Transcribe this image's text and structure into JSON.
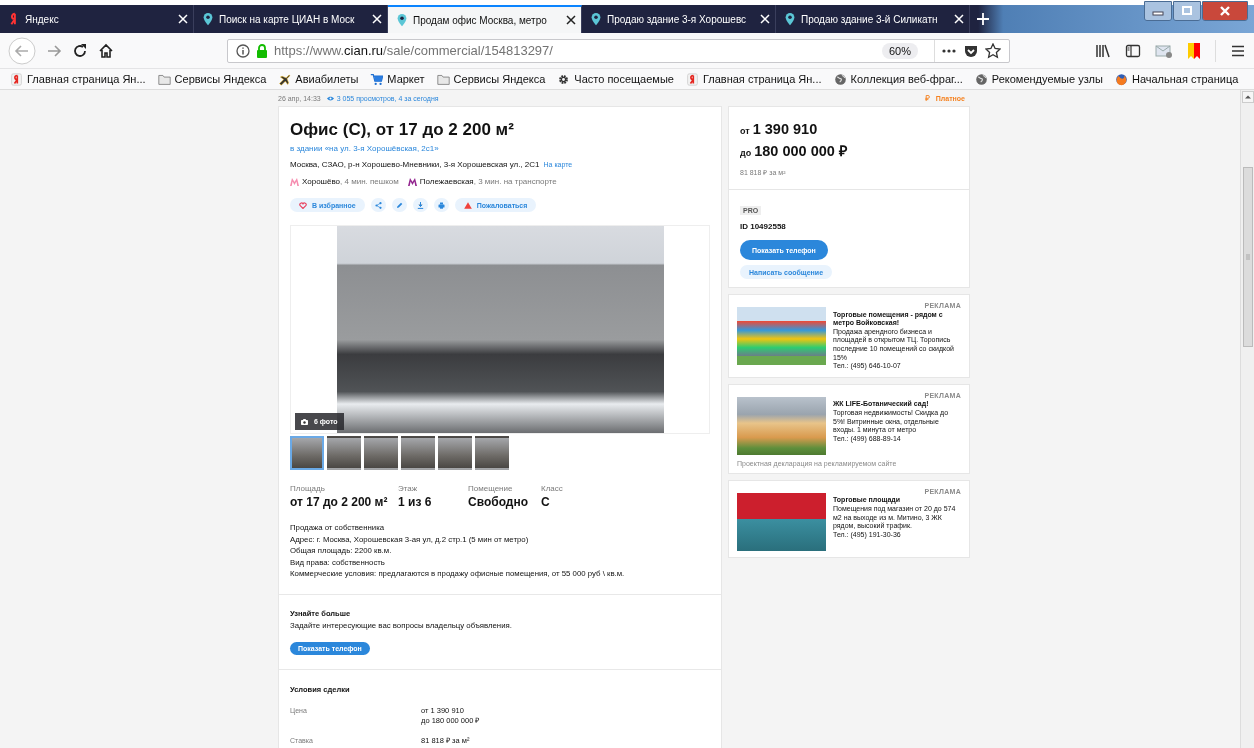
{
  "browser": {
    "tabs": [
      {
        "title": "Яндекс",
        "selected": false
      },
      {
        "title": "Поиск на карте ЦИАН в Моск",
        "selected": false
      },
      {
        "title": "Продам офис Москва, метро",
        "selected": true
      },
      {
        "title": "Продаю здание 3-я Хорошевс",
        "selected": false
      },
      {
        "title": "Продаю здание 3-й Силикатн",
        "selected": false
      }
    ],
    "address_bar": {
      "url_host": "https://www.cian.ru",
      "url_path": "/sale/commercial/154813297/",
      "zoom": "60%"
    },
    "bookmarks": [
      {
        "label": "Главная страница Ян..."
      },
      {
        "label": "Сервисы Яндекса"
      },
      {
        "label": "Авиабилеты"
      },
      {
        "label": "Маркет"
      },
      {
        "label": "Сервисы Яндекса"
      },
      {
        "label": "Часто посещаемые"
      },
      {
        "label": "Главная страница Ян..."
      },
      {
        "label": "Коллекция веб-фраг..."
      },
      {
        "label": "Рекомендуемые узлы"
      },
      {
        "label": "Начальная страница"
      }
    ]
  },
  "listing": {
    "published": "26 апр, 14:33",
    "views": "3 055 просмотров, 4 за сегодня",
    "paid_label": "Платное",
    "title": "Офис (С), от 17 до 2 200 м²",
    "building_link": "в здании «на ул. 3-я Хорошёвская, 2с1»",
    "address": "Москва, СЗАО, р-н Хорошево-Мневники, 3-я Хорошевская ул., 2С1",
    "map_link": "На карте",
    "metro": [
      {
        "station": "Хорошёво",
        "distance": ", 4 мин. пешком",
        "color": "#f68db0"
      },
      {
        "station": "Полежаевская",
        "distance": ", 3 мин. на транспорте",
        "color": "#93258f"
      }
    ],
    "actions": [
      {
        "kind": "favorite",
        "label": "В избранное"
      },
      {
        "kind": "share"
      },
      {
        "kind": "edit"
      },
      {
        "kind": "download"
      },
      {
        "kind": "print"
      },
      {
        "kind": "report",
        "label": "Пожаловаться"
      }
    ],
    "photo_count": "6 фото",
    "thumbnails": [
      {
        "selected": true
      },
      {
        "selected": false
      },
      {
        "selected": false
      },
      {
        "selected": false
      },
      {
        "selected": false
      },
      {
        "selected": false
      }
    ],
    "facts": [
      {
        "label": "Площадь",
        "value": "от 17 до 2 200 м²"
      },
      {
        "label": "Этаж",
        "value": "1 из 6"
      },
      {
        "label": "Помещение",
        "value": "Свободно"
      },
      {
        "label": "Класс",
        "value": "С"
      }
    ],
    "description": [
      "Продажа от собственника",
      "Адрес: г. Москва, Хорошевская 3-ая ул, д.2 стр.1 (5 мин от метро)",
      "Общая площадь: 2200 кв.м.",
      "Вид права: собственность",
      "Коммерческие условия: предлагаются в продажу офисные помещения, от 55 000 руб \\ кв.м."
    ],
    "contact": {
      "title": "Узнайте больше",
      "text": "Задайте интересующие вас вопросы владельцу объявления.",
      "button": "Показать телефон"
    },
    "deal_terms": {
      "title": "Условия сделки",
      "rows": [
        {
          "label": "Цена",
          "lines": [
            "от 1 390 910",
            "до 180 000 000 ₽"
          ]
        },
        {
          "label": "Ставка",
          "lines": [
            "81 818 ₽ за м²"
          ]
        }
      ]
    }
  },
  "sidebar": {
    "price_from_prefix": "от",
    "price_from": "1 390 910",
    "price_to_prefix": "до",
    "price_to": "180 000 000 ₽",
    "price_per_m2": "81 818 ₽ за м²",
    "badge": "PRO",
    "agent_id": "ID 10492558",
    "phone_button": "Показать телефон",
    "message_button": "Написать сообщение",
    "ads": [
      {
        "label": "РЕКЛАМА",
        "title": "Торговые помещения - рядом с метро Войковская!",
        "text": "Продажа арендного бизнеса и площадей в открытом ТЦ. Торопись последние 10 помещений со скидкой 15%",
        "phone": "Тел.: (495) 646-10-07"
      },
      {
        "label": "РЕКЛАМА",
        "title": "ЖК LIFE-Ботанический сад!",
        "text": "Торговая недвижимость! Скидка до 5%! Витринные окна, отдельные входы. 1 минута от метро",
        "phone": "Тел.: (499) 688-89-14",
        "note": "Проектная декларация на рекламируемом сайте"
      },
      {
        "label": "РЕКЛАМА",
        "title": "Торговые площади",
        "text": "Помещения под магазин от 20 до 574 м2 на выходе из м. Митино, 3 ЖК рядом, высокий трафик.",
        "phone": "Тел.: (495) 191-30-36"
      }
    ]
  }
}
